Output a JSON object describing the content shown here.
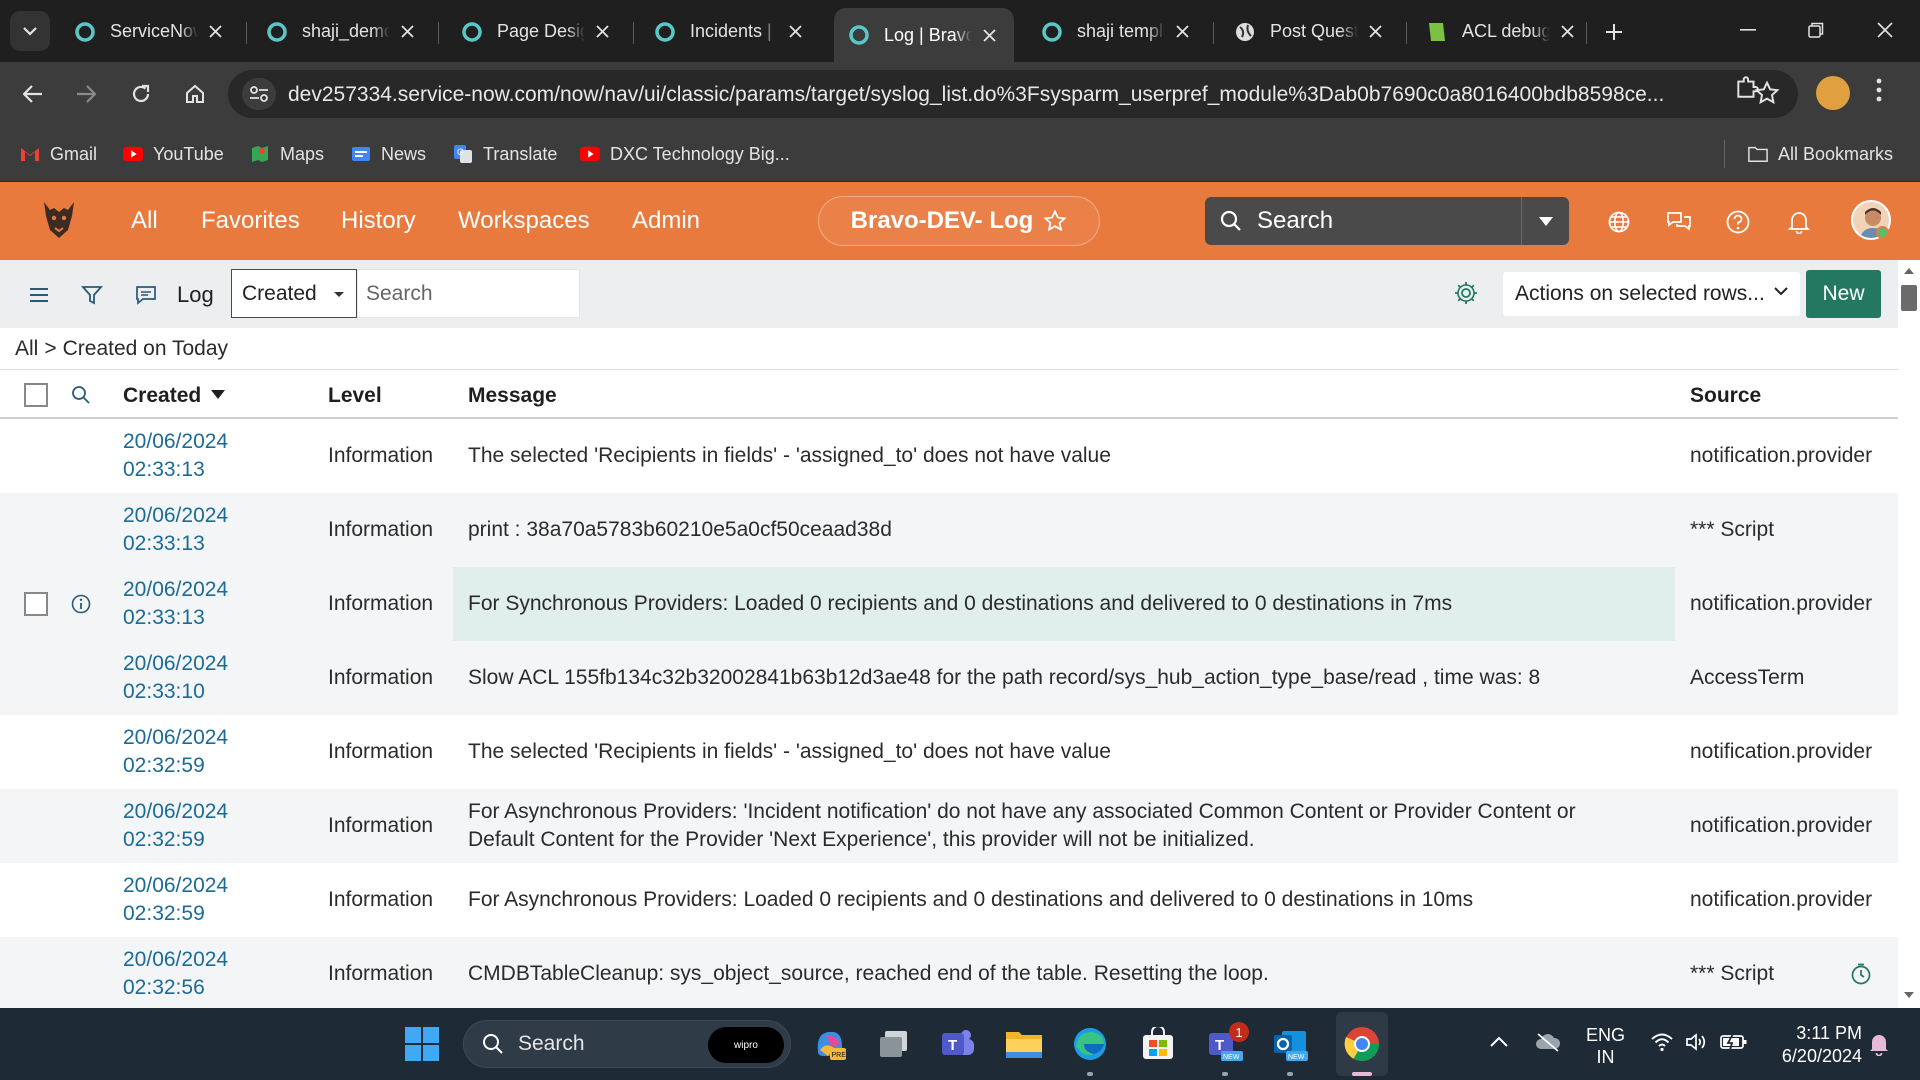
{
  "browser": {
    "tabs": [
      {
        "title": "ServiceNow",
        "active": false
      },
      {
        "title": "shaji_demo",
        "active": false
      },
      {
        "title": "Page Designer",
        "active": false
      },
      {
        "title": "Incidents | ServiceNow",
        "active": false
      },
      {
        "title": "Log | Bravo-DEV",
        "active": true
      },
      {
        "title": "shaji template",
        "active": false
      },
      {
        "title": "Post Question",
        "active": false
      },
      {
        "title": "ACL debug",
        "active": false
      }
    ],
    "url": "dev257334.service-now.com/now/nav/ui/classic/params/target/syslog_list.do%3Fsysparm_userpref_module%3Dab0b7690c0a8016400bdb8598ce...",
    "bookmarks": [
      {
        "label": "Gmail",
        "icon": "gmail-icon"
      },
      {
        "label": "YouTube",
        "icon": "youtube-icon"
      },
      {
        "label": "Maps",
        "icon": "maps-icon"
      },
      {
        "label": "News",
        "icon": "news-icon"
      },
      {
        "label": "Translate",
        "icon": "translate-icon"
      },
      {
        "label": "DXC Technology Big...",
        "icon": "youtube-icon"
      }
    ],
    "all_bookmarks_label": "All Bookmarks"
  },
  "servicenow": {
    "nav": [
      "All",
      "Favorites",
      "History",
      "Workspaces",
      "Admin"
    ],
    "context_title": "Bravo-DEV- Log",
    "search_placeholder": "Search",
    "brand_color": "#e97a3e"
  },
  "list": {
    "title": "Log",
    "field_select_value": "Created",
    "search_placeholder": "Search",
    "actions_label": "Actions on selected rows...",
    "new_label": "New",
    "breadcrumb": {
      "root": "All",
      "sep": ">",
      "filter": "Created on Today"
    },
    "columns": {
      "created": "Created",
      "level": "Level",
      "message": "Message",
      "source": "Source"
    },
    "rows": [
      {
        "created_date": "20/06/2024",
        "created_time": "02:33:13",
        "level": "Information",
        "message": "The selected 'Recipients in fields' - 'assigned_to' does not have value",
        "source": "notification.provider"
      },
      {
        "created_date": "20/06/2024",
        "created_time": "02:33:13",
        "level": "Information",
        "message": "print : 38a70a5783b60210e5a0cf50ceaad38d",
        "source": "*** Script"
      },
      {
        "created_date": "20/06/2024",
        "created_time": "02:33:13",
        "level": "Information",
        "message": "For Synchronous Providers: Loaded 0 recipients and 0 destinations and delivered to 0 destinations in 7ms",
        "source": "notification.provider"
      },
      {
        "created_date": "20/06/2024",
        "created_time": "02:33:10",
        "level": "Information",
        "message": "Slow ACL 155fb134c32b32002841b63b12d3ae48 for the path record/sys_hub_action_type_base/read , time was: 8",
        "source": "AccessTerm"
      },
      {
        "created_date": "20/06/2024",
        "created_time": "02:32:59",
        "level": "Information",
        "message": "The selected 'Recipients in fields' - 'assigned_to' does not have value",
        "source": "notification.provider"
      },
      {
        "created_date": "20/06/2024",
        "created_time": "02:32:59",
        "level": "Information",
        "message": "For Asynchronous Providers: 'Incident notification' do not have any associated Common Content or Provider Content or Default Content for the Provider 'Next Experience', this provider will not be initialized.",
        "source": "notification.provider"
      },
      {
        "created_date": "20/06/2024",
        "created_time": "02:32:59",
        "level": "Information",
        "message": "For Asynchronous Providers: Loaded 0 recipients and 0 destinations and delivered to 0 destinations in 10ms",
        "source": "notification.provider"
      },
      {
        "created_date": "20/06/2024",
        "created_time": "02:32:56",
        "level": "Information",
        "message": "CMDBTableCleanup: sys_object_source, reached end of the table. Resetting the loop.",
        "source": "*** Script"
      }
    ]
  },
  "taskbar": {
    "search_placeholder": "Search",
    "search_badge": "wipro",
    "teams_badge_count": "1",
    "language_line1": "ENG",
    "language_line2": "IN",
    "time": "3:11 PM",
    "date": "6/20/2024"
  }
}
